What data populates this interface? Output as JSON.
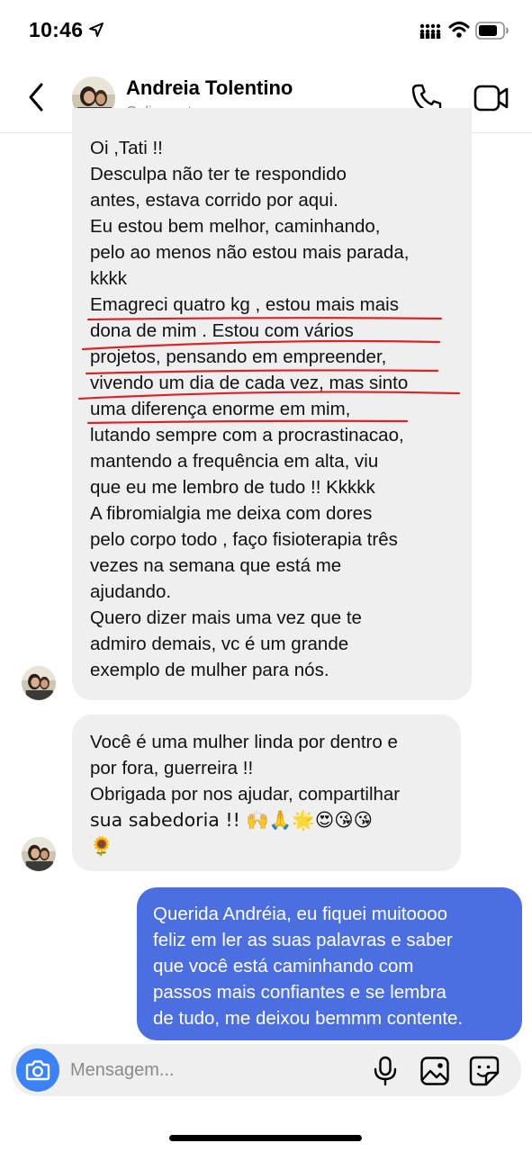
{
  "status_bar": {
    "time": "10:46"
  },
  "header": {
    "contact_name": "Andreia Tolentino",
    "contact_status": "Online ontem"
  },
  "messages": [
    {
      "direction": "incoming",
      "lines": [
        "Oi ,Tati !!",
        "Desculpa não ter te respondido",
        "antes, estava corrido por aqui.",
        "Eu estou bem melhor, caminhando,",
        "pelo ao menos não estou mais parada,",
        "kkkk",
        "Emagreci quatro kg , estou mais mais",
        "dona de mim . Estou com vários",
        "projetos, pensando em empreender,",
        "vivendo um dia de cada vez, mas sinto",
        "uma diferença  enorme em mim,",
        "lutando sempre com a procrastinacao,",
        "mantendo a frequência  em alta, viu",
        "que eu me lembro de tudo !! Kkkkk",
        "A fibromialgia me deixa com dores",
        "pelo corpo todo , faço fisioterapia três",
        "vezes na semana que está me",
        "ajudando.",
        "Quero dizer mais uma vez que te",
        "admiro demais, vc é  um grande",
        "exemplo de mulher para nós."
      ]
    },
    {
      "direction": "incoming",
      "lines": [
        "Você é uma mulher linda por dentro e",
        "por fora, guerreira !!",
        "Obrigada por nos ajudar, compartilhar",
        "sua sabedoria !! 🙌🙏🌟😍😘😘",
        "🌻"
      ]
    },
    {
      "direction": "outgoing",
      "lines": [
        "Querida Andréia, eu fiquei muitoooo",
        "feliz em ler as suas palavras e saber",
        "que você está caminhando com",
        "passos mais confiantes e se lembra",
        "de tudo, me deixou bemmm contente."
      ]
    }
  ],
  "composer": {
    "placeholder": "Mensagem..."
  },
  "colors": {
    "outgoing_bubble": "#4b6fe0",
    "incoming_bubble": "#efefef",
    "camera_button": "#3b82f6",
    "underline_annotation": "#d9252a"
  }
}
